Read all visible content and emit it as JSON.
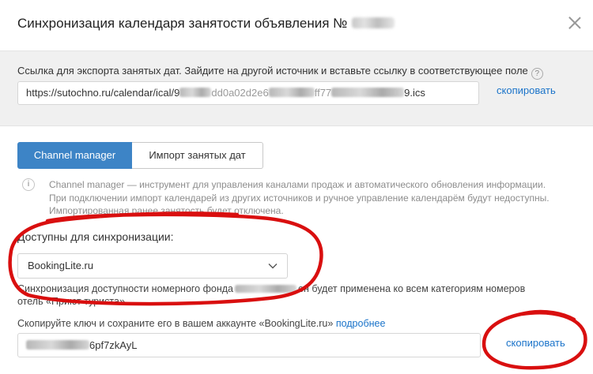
{
  "dialog": {
    "title": "Синхронизация календаря занятости объявления №",
    "close_icon": "close-icon"
  },
  "export": {
    "label": "Ссылка для экспорта занятых дат. Зайдите на другой источник и вставьте ссылку в соответствующее поле",
    "help_icon": "?",
    "url_prefix": "https://sutochno.ru/calendar/ical/9",
    "url_suffix": "9.ics",
    "copy_label": "скопировать"
  },
  "tabs": [
    {
      "label": "Channel manager",
      "active": true
    },
    {
      "label": "Импорт занятых дат",
      "active": false
    }
  ],
  "info": {
    "icon": "i",
    "lines": [
      "Channel manager — инструмент для управления каналами продаж и автоматического обновления информации.",
      "При подключении импорт календарей из других источников и ручное управление календарём будут недоступны.",
      "Импортированная ранее занятость будет отключена."
    ]
  },
  "sync": {
    "label": "Доступны для синхронизации:",
    "selected": "BookingLite.ru",
    "note_line1": "Синхронизация доступности номерного фонда",
    "note_line1_end": "ен будет применена ко всем категориям номеров",
    "note_line2": "отель «Приют туриста»"
  },
  "key": {
    "label_text": "Скопируйте ключ и сохраните его в вашем аккаунте «BookingLite.ru»",
    "more_link": "подробнее",
    "value_suffix": "6pf7zkAyL",
    "copy_label": "скопировать"
  },
  "colors": {
    "accent": "#3d84c6",
    "link": "#1a73c9",
    "annotation": "#d90f0f"
  }
}
